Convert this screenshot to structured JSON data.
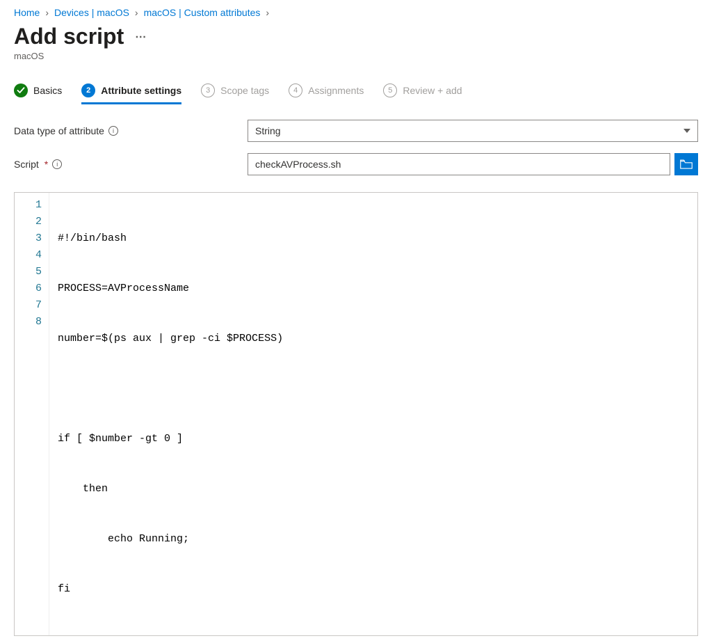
{
  "breadcrumb": {
    "home": "Home",
    "devices": "Devices | macOS",
    "custom": "macOS | Custom attributes"
  },
  "page": {
    "title": "Add script",
    "subtitle": "macOS"
  },
  "tabs": {
    "basics": "Basics",
    "attr_num": "2",
    "attr": "Attribute settings",
    "scope_num": "3",
    "scope": "Scope tags",
    "assign_num": "4",
    "assign": "Assignments",
    "review_num": "5",
    "review": "Review + add"
  },
  "form": {
    "data_type_label": "Data type of attribute",
    "data_type_value": "String",
    "script_label": "Script",
    "script_value": "checkAVProcess.sh"
  },
  "editor": {
    "lines": [
      "#!/bin/bash",
      "PROCESS=AVProcessName",
      "number=$(ps aux | grep -ci $PROCESS)",
      "",
      "if [ $number -gt 0 ]",
      "    then",
      "        echo Running;",
      "fi"
    ]
  }
}
